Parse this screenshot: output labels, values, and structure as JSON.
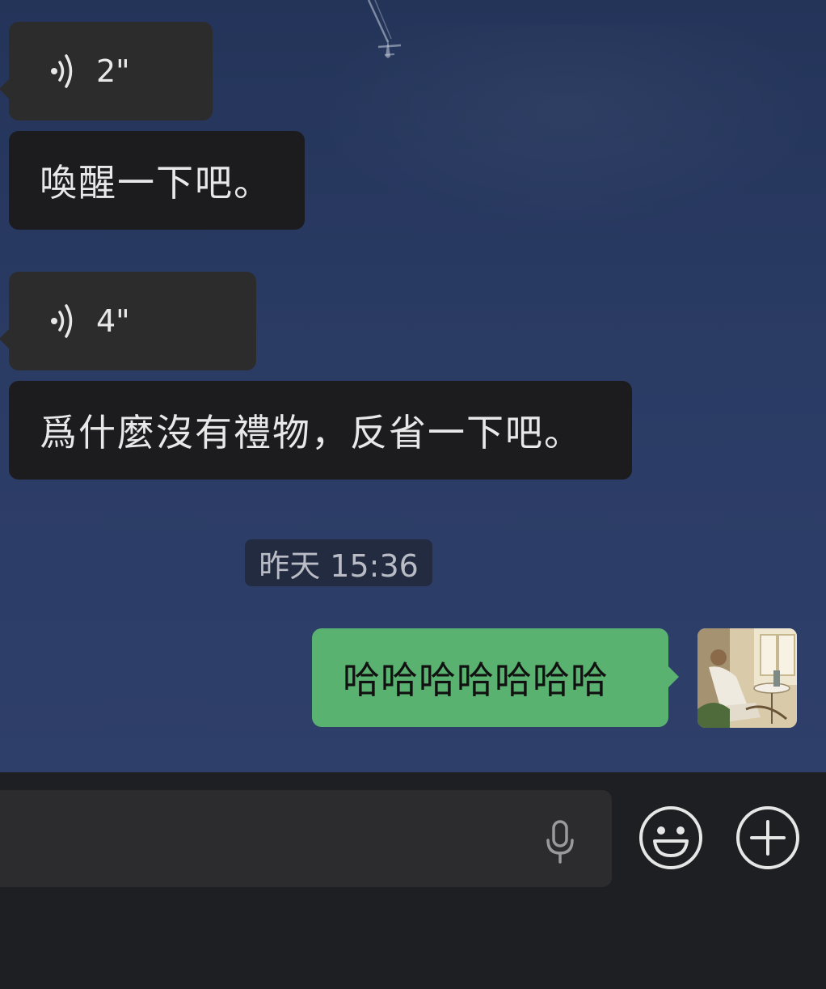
{
  "messages": [
    {
      "type": "voice",
      "duration": "2\""
    },
    {
      "type": "text",
      "text": "喚醒一下吧。"
    },
    {
      "type": "voice",
      "duration": "4\""
    },
    {
      "type": "text",
      "text": "爲什麼沒有禮物，反省一下吧。"
    }
  ],
  "timestamp": "昨天 15:36",
  "sent_message": "哈哈哈哈哈哈哈",
  "icons": {
    "voice_wave": "voice-wave-icon",
    "microphone": "microphone-icon",
    "emoji": "emoji-icon",
    "add": "plus-icon"
  },
  "colors": {
    "chat_background": "#2a3b64",
    "received_bubble": "#1c1c1e",
    "voice_bubble": "#2c2c2c",
    "sent_bubble": "#5ab270",
    "input_bar": "#1e1f23"
  }
}
